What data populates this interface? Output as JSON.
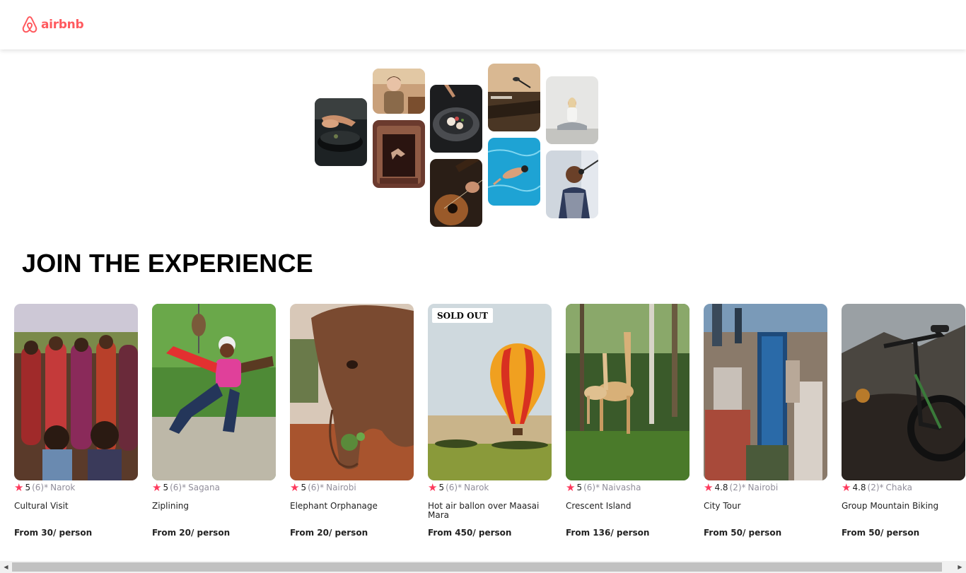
{
  "header": {
    "logo_text": "airbnb",
    "brand_color": "#FF5A5F"
  },
  "hero": {
    "photos": [
      "cooking",
      "chef-portrait",
      "theatre-dancer",
      "plated-food",
      "guitar",
      "microphone-stage",
      "swimmer",
      "yoga",
      "singer"
    ]
  },
  "section": {
    "title": "JOIN THE EXPERIENCE"
  },
  "accent_star_color": "#FE395C",
  "cards": [
    {
      "rating": "5",
      "reviews": "(6)",
      "location": "Narok",
      "title": "Cultural Visit",
      "price": "From 30/ person",
      "badge": "",
      "image": "maasai-group"
    },
    {
      "rating": "5",
      "reviews": "(6)",
      "location": "Sagana",
      "title": "Ziplining",
      "price": "From 20/ person",
      "badge": "",
      "image": "zipline"
    },
    {
      "rating": "5",
      "reviews": "(6)",
      "location": "Nairobi",
      "title": "Elephant Orphanage",
      "price": "From 20/ person",
      "badge": "",
      "image": "elephant"
    },
    {
      "rating": "5",
      "reviews": "(6)",
      "location": "Narok",
      "title": "Hot air ballon over Maasai Mara",
      "price": "From 450/ person",
      "badge": "SOLD OUT",
      "image": "hot-air-balloon"
    },
    {
      "rating": "5",
      "reviews": "(6)",
      "location": "Naivasha",
      "title": "Crescent Island",
      "price": "From 136/ person",
      "badge": "",
      "image": "giraffes"
    },
    {
      "rating": "4.8",
      "reviews": "(2)",
      "location": "Nairobi",
      "title": "City Tour",
      "price": "From 50/ person",
      "badge": "",
      "image": "city-skyline"
    },
    {
      "rating": "4.8",
      "reviews": "(2)",
      "location": "Chaka",
      "title": "Group Mountain Biking",
      "price": "From 50/ person",
      "badge": "",
      "image": "mountain-bike"
    }
  ]
}
